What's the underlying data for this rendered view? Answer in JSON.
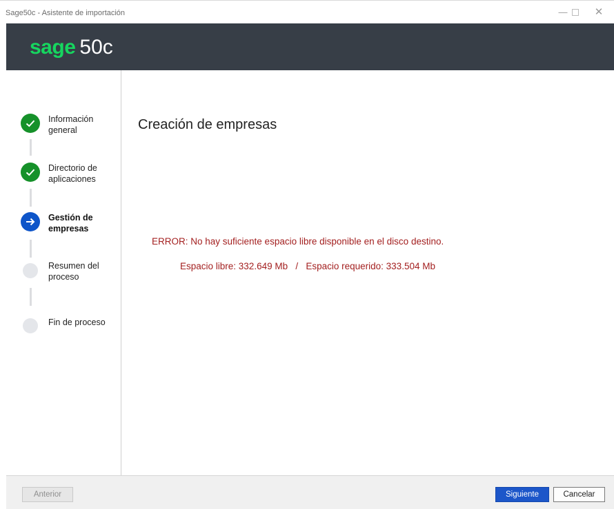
{
  "window": {
    "title": "Sage50c - Asistente de importación",
    "controls": {
      "minimize": "—",
      "maximize": "☐",
      "close": "✕"
    }
  },
  "header": {
    "logo_brand": "sage",
    "logo_version": "50c",
    "brand_color": "#16d65f",
    "background_color": "#373e47"
  },
  "steps": [
    {
      "label": "Información general",
      "state": "done",
      "icon": "check-icon"
    },
    {
      "label": "Directorio de aplicaciones",
      "state": "done",
      "icon": "check-icon"
    },
    {
      "label": "Gestión de empresas",
      "state": "current",
      "icon": "arrow-right-icon"
    },
    {
      "label": "Resumen del proceso",
      "state": "pending",
      "icon": "dot-icon"
    },
    {
      "label": "Fin de proceso",
      "state": "pending",
      "icon": "dot-icon"
    }
  ],
  "main": {
    "title": "Creación de empresas",
    "error_message": "ERROR: No hay suficiente espacio libre disponible en el disco destino.",
    "space_info": "Espacio libre: 332.649 Mb   /   Espacio requerido: 333.504 Mb",
    "error_color": "#a31f1f"
  },
  "footer": {
    "prev_label": "Anterior",
    "next_label": "Siguiente",
    "cancel_label": "Cancelar",
    "accent_color": "#1c56c9"
  }
}
